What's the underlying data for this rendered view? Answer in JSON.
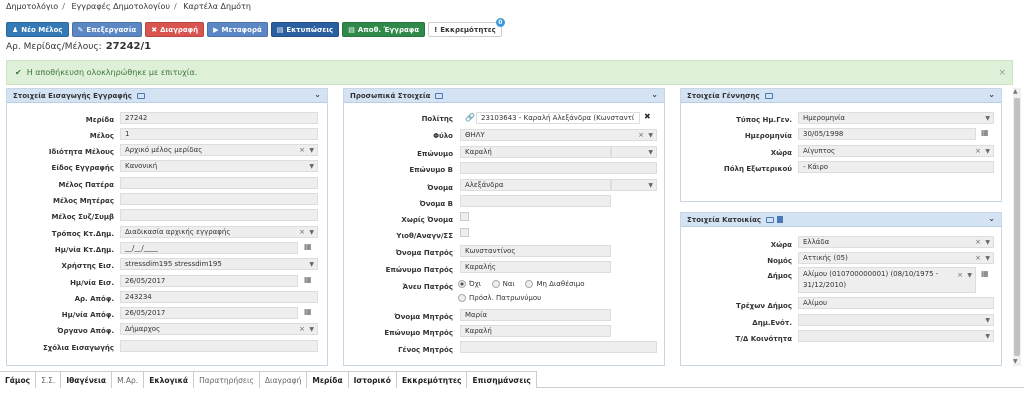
{
  "breadcrumb": [
    "Δημοτολόγιο",
    "Εγγραφές Δημοτολογίου",
    "Καρτέλα Δημότη"
  ],
  "toolbar": {
    "new_member": "Νέο Μέλος",
    "edit": "Επεξεργασία",
    "delete": "Διαγραφή",
    "transfer": "Μεταφορά",
    "prints": "Εκτυπώσεις",
    "saved_docs": "Αποθ. Έγγραφα",
    "pending": "Εκκρεμότητες",
    "pending_count": "0"
  },
  "merida": {
    "label": "Αρ. Μερίδας/Μέλους:",
    "value": "27242/1"
  },
  "alert": {
    "message": "Η αποθήκευση ολοκληρώθηκε με επιτυχία.",
    "close": "×"
  },
  "panel1": {
    "title": "Στοιχεία Εισαγωγής Εγγραφής",
    "fields": [
      {
        "label": "Μερίδα",
        "value": "27242"
      },
      {
        "label": "Μέλος",
        "value": "1"
      },
      {
        "label": "Ιδιότητα Μέλους",
        "value": "Αρχικό μέλος μερίδας"
      },
      {
        "label": "Είδος Εγγραφής",
        "value": "Κανονική"
      },
      {
        "label": "Μέλος Πατέρα",
        "value": ""
      },
      {
        "label": "Μέλος Μητέρας",
        "value": ""
      },
      {
        "label": "Μέλος Συζ/Συμβ",
        "value": ""
      },
      {
        "label": "Τρόπος Κτ.Δημ.",
        "value": "Διαδικασία αρχικής εγγραφής"
      },
      {
        "label": "Ημ/νία Κτ.Δημ.",
        "value": "__/__/____"
      },
      {
        "label": "Χρήστης Εισ.",
        "value": "stressdim195 stressdim195"
      },
      {
        "label": "Ημ/νία Εισ.",
        "value": "26/05/2017"
      },
      {
        "label": "Αρ. Απόφ.",
        "value": "243234"
      },
      {
        "label": "Ημ/νία Απόφ.",
        "value": "26/05/2017"
      },
      {
        "label": "Όργανο Απόφ.",
        "value": "Δήμαρχος"
      },
      {
        "label": "Σχόλια Εισαγωγής",
        "value": ""
      }
    ]
  },
  "panel2": {
    "title": "Προσωπικά Στοιχεία",
    "citizen_label": "Πολίτης",
    "citizen_value": "23103643 - Καραλή Αλεξάνδρα (Κωνσταντί",
    "gender_label": "Φύλο",
    "gender_value": "ΘΗΛΥ",
    "surname_label": "Επώνυμο",
    "surname_value": "Καραλή",
    "surname_b_label": "Επώνυμο Β",
    "surname_b_value": "",
    "name_label": "Όνομα",
    "name_value": "Αλεξάνδρα",
    "name_b_label": "Όνομα Β",
    "name_b_value": "",
    "no_name_label": "Χωρίς Όνομα",
    "adopted_label": "Υιοθ/Αναγν/ΣΣ",
    "father_name_label": "Όνομα Πατρός",
    "father_name_value": "Κωνσταντίνος",
    "father_surname_label": "Επώνυμο Πατρός",
    "father_surname_value": "Καραλής",
    "no_father_label": "Άνευ Πατρός",
    "radio_no": "Όχι",
    "radio_yes": "Ναι",
    "radio_na": "Μη Διαθέσιμο",
    "radio_stepfather": "Πρόσλ. Πατρωνύμου",
    "mother_name_label": "Όνομα Μητρός",
    "mother_name_value": "Μαρία",
    "mother_surname_label": "Επώνυμο Μητρός",
    "mother_surname_value": "Καραλή",
    "mother_genos_label": "Γένος Μητρός",
    "mother_genos_value": ""
  },
  "panel3": {
    "title": "Στοιχεία Γέννησης",
    "date_type_label": "Τύπος Ημ.Γεν.",
    "date_type_value": "Ημερομηνία",
    "date_label": "Ημερομηνία",
    "date_value": "30/05/1998",
    "country_label": "Χώρα",
    "country_value": "Αίγυπτος",
    "foreign_city_label": "Πόλη Εξωτερικού",
    "foreign_city_value": "- Κάιρο"
  },
  "panel4": {
    "title": "Στοιχεία Κατοικίας",
    "country_label": "Χώρα",
    "country_value": "Ελλάδα",
    "prefecture_label": "Νομός",
    "prefecture_value": "Αττικής (05)",
    "municipality_label": "Δήμος",
    "municipality_value_1": "Αλίμου (010700000001) (08/10/1975 -",
    "municipality_value_2": "31/12/2010)",
    "current_muni_label": "Τρέχων Δήμος",
    "current_muni_value": "Αλίμου",
    "unit_label": "Δημ.Ενότ.",
    "unit_value": "",
    "community_label": "Τ/Δ Κοινότητα",
    "community_value": ""
  },
  "tabs": [
    {
      "label": "Γάμος",
      "light": false
    },
    {
      "label": "Σ.Σ.",
      "light": true
    },
    {
      "label": "Ιθαγένεια",
      "light": false
    },
    {
      "label": "Μ.Αρ.",
      "light": true
    },
    {
      "label": "Εκλογικά",
      "light": false
    },
    {
      "label": "Παρατηρήσεις",
      "light": true
    },
    {
      "label": "Διαγραφή",
      "light": true
    },
    {
      "label": "Μερίδα",
      "light": false
    },
    {
      "label": "Ιστορικό",
      "light": false
    },
    {
      "label": "Εκκρεμότητες",
      "light": false
    },
    {
      "label": "Επισημάνσεις",
      "light": false
    }
  ]
}
